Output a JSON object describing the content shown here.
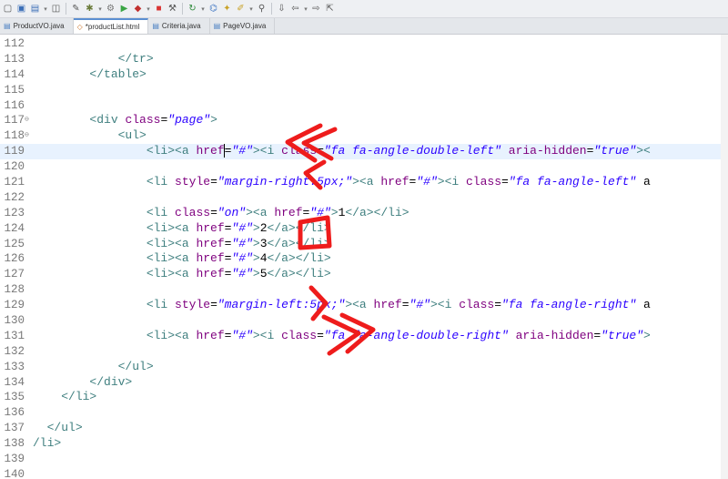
{
  "toolbar": {
    "icons": [
      "new-file-icon",
      "save-icon",
      "save-all-icon",
      "window-icon",
      "pin-icon",
      "bug-icon",
      "gear-icon",
      "run-icon",
      "external-tools-icon",
      "stop-icon",
      "build-icon",
      "refresh-icon",
      "plugin-icon",
      "wand-icon",
      "brush-icon",
      "search-icon",
      "arrow-down-icon",
      "back-icon",
      "forward-icon",
      "export-icon"
    ]
  },
  "tabs": [
    {
      "label": "ProductVO.java",
      "icon": "java-file-icon",
      "active": false
    },
    {
      "label": "*productList.html",
      "icon": "html-file-icon",
      "active": true
    },
    {
      "label": "Criteria.java",
      "icon": "java-file-icon",
      "active": false
    },
    {
      "label": "PageVO.java",
      "icon": "java-file-icon",
      "active": false
    }
  ],
  "editor": {
    "current_line": "119",
    "lines": [
      {
        "num": "112",
        "fold": "",
        "tokens": []
      },
      {
        "num": "113",
        "fold": "",
        "tokens": [
          {
            "t": "txt",
            "v": "            "
          },
          {
            "t": "tag",
            "v": "</tr>"
          }
        ]
      },
      {
        "num": "114",
        "fold": "",
        "tokens": [
          {
            "t": "txt",
            "v": "        "
          },
          {
            "t": "tag",
            "v": "</table>"
          }
        ]
      },
      {
        "num": "115",
        "fold": "",
        "tokens": []
      },
      {
        "num": "116",
        "fold": "",
        "tokens": []
      },
      {
        "num": "117",
        "fold": "⊖",
        "tokens": [
          {
            "t": "txt",
            "v": "        "
          },
          {
            "t": "tag",
            "v": "<div "
          },
          {
            "t": "attr",
            "v": "class"
          },
          {
            "t": "txt",
            "v": "="
          },
          {
            "t": "val",
            "v": "\"page\""
          },
          {
            "t": "tag",
            "v": ">"
          }
        ]
      },
      {
        "num": "118",
        "fold": "⊖",
        "tokens": [
          {
            "t": "txt",
            "v": "            "
          },
          {
            "t": "tag",
            "v": "<ul>"
          }
        ]
      },
      {
        "num": "119",
        "fold": "",
        "tokens": [
          {
            "t": "txt",
            "v": "                "
          },
          {
            "t": "tag",
            "v": "<li><a "
          },
          {
            "t": "attr",
            "v": "href"
          },
          {
            "t": "caret",
            "v": "="
          },
          {
            "t": "val",
            "v": "\"#\""
          },
          {
            "t": "tag",
            "v": "><i "
          },
          {
            "t": "attr",
            "v": "class"
          },
          {
            "t": "txt",
            "v": "="
          },
          {
            "t": "val",
            "v": "\"fa fa-angle-double-left\""
          },
          {
            "t": "txt",
            "v": " "
          },
          {
            "t": "attr",
            "v": "aria-hidden"
          },
          {
            "t": "txt",
            "v": "="
          },
          {
            "t": "val",
            "v": "\"true\""
          },
          {
            "t": "tag",
            "v": "><"
          }
        ]
      },
      {
        "num": "120",
        "fold": "",
        "tokens": []
      },
      {
        "num": "121",
        "fold": "",
        "tokens": [
          {
            "t": "txt",
            "v": "                "
          },
          {
            "t": "tag",
            "v": "<li "
          },
          {
            "t": "attr",
            "v": "style"
          },
          {
            "t": "txt",
            "v": "="
          },
          {
            "t": "val",
            "v": "\"margin-right:5px;\""
          },
          {
            "t": "tag",
            "v": "><a "
          },
          {
            "t": "attr",
            "v": "href"
          },
          {
            "t": "txt",
            "v": "="
          },
          {
            "t": "val",
            "v": "\"#\""
          },
          {
            "t": "tag",
            "v": "><i "
          },
          {
            "t": "attr",
            "v": "class"
          },
          {
            "t": "txt",
            "v": "="
          },
          {
            "t": "val",
            "v": "\"fa fa-angle-left\""
          },
          {
            "t": "txt",
            "v": " a"
          }
        ]
      },
      {
        "num": "122",
        "fold": "",
        "tokens": []
      },
      {
        "num": "123",
        "fold": "",
        "tokens": [
          {
            "t": "txt",
            "v": "                "
          },
          {
            "t": "tag",
            "v": "<li "
          },
          {
            "t": "attr",
            "v": "class"
          },
          {
            "t": "txt",
            "v": "="
          },
          {
            "t": "val",
            "v": "\"on\""
          },
          {
            "t": "tag",
            "v": "><a "
          },
          {
            "t": "attr",
            "v": "href"
          },
          {
            "t": "txt",
            "v": "="
          },
          {
            "t": "val",
            "v": "\"#\""
          },
          {
            "t": "tag",
            "v": ">"
          },
          {
            "t": "txt",
            "v": "1"
          },
          {
            "t": "tag",
            "v": "</a></li>"
          }
        ]
      },
      {
        "num": "124",
        "fold": "",
        "tokens": [
          {
            "t": "txt",
            "v": "                "
          },
          {
            "t": "tag",
            "v": "<li><a "
          },
          {
            "t": "attr",
            "v": "href"
          },
          {
            "t": "txt",
            "v": "="
          },
          {
            "t": "val",
            "v": "\"#\""
          },
          {
            "t": "tag",
            "v": ">"
          },
          {
            "t": "txt",
            "v": "2"
          },
          {
            "t": "tag",
            "v": "</a></li>"
          }
        ]
      },
      {
        "num": "125",
        "fold": "",
        "tokens": [
          {
            "t": "txt",
            "v": "                "
          },
          {
            "t": "tag",
            "v": "<li><a "
          },
          {
            "t": "attr",
            "v": "href"
          },
          {
            "t": "txt",
            "v": "="
          },
          {
            "t": "val",
            "v": "\"#\""
          },
          {
            "t": "tag",
            "v": ">"
          },
          {
            "t": "txt",
            "v": "3"
          },
          {
            "t": "tag",
            "v": "</a></li>"
          }
        ]
      },
      {
        "num": "126",
        "fold": "",
        "tokens": [
          {
            "t": "txt",
            "v": "                "
          },
          {
            "t": "tag",
            "v": "<li><a "
          },
          {
            "t": "attr",
            "v": "href"
          },
          {
            "t": "txt",
            "v": "="
          },
          {
            "t": "val",
            "v": "\"#\""
          },
          {
            "t": "tag",
            "v": ">"
          },
          {
            "t": "txt",
            "v": "4"
          },
          {
            "t": "tag",
            "v": "</a></li>"
          }
        ]
      },
      {
        "num": "127",
        "fold": "",
        "tokens": [
          {
            "t": "txt",
            "v": "                "
          },
          {
            "t": "tag",
            "v": "<li><a "
          },
          {
            "t": "attr",
            "v": "href"
          },
          {
            "t": "txt",
            "v": "="
          },
          {
            "t": "val",
            "v": "\"#\""
          },
          {
            "t": "tag",
            "v": ">"
          },
          {
            "t": "txt",
            "v": "5"
          },
          {
            "t": "tag",
            "v": "</a></li>"
          }
        ]
      },
      {
        "num": "128",
        "fold": "",
        "tokens": []
      },
      {
        "num": "129",
        "fold": "",
        "tokens": [
          {
            "t": "txt",
            "v": "                "
          },
          {
            "t": "tag",
            "v": "<li "
          },
          {
            "t": "attr",
            "v": "style"
          },
          {
            "t": "txt",
            "v": "="
          },
          {
            "t": "val",
            "v": "\"margin-left:5px;\""
          },
          {
            "t": "tag",
            "v": "><a "
          },
          {
            "t": "attr",
            "v": "href"
          },
          {
            "t": "txt",
            "v": "="
          },
          {
            "t": "val",
            "v": "\"#\""
          },
          {
            "t": "tag",
            "v": "><i "
          },
          {
            "t": "attr",
            "v": "class"
          },
          {
            "t": "txt",
            "v": "="
          },
          {
            "t": "val",
            "v": "\"fa fa-angle-right\""
          },
          {
            "t": "txt",
            "v": " a"
          }
        ]
      },
      {
        "num": "130",
        "fold": "",
        "tokens": []
      },
      {
        "num": "131",
        "fold": "",
        "tokens": [
          {
            "t": "txt",
            "v": "                "
          },
          {
            "t": "tag",
            "v": "<li><a "
          },
          {
            "t": "attr",
            "v": "href"
          },
          {
            "t": "txt",
            "v": "="
          },
          {
            "t": "val",
            "v": "\"#\""
          },
          {
            "t": "tag",
            "v": "><i "
          },
          {
            "t": "attr",
            "v": "class"
          },
          {
            "t": "txt",
            "v": "="
          },
          {
            "t": "val",
            "v": "\"fa fa-angle-double-right\""
          },
          {
            "t": "txt",
            "v": " "
          },
          {
            "t": "attr",
            "v": "aria-hidden"
          },
          {
            "t": "txt",
            "v": "="
          },
          {
            "t": "val",
            "v": "\"true\""
          },
          {
            "t": "tag",
            "v": ">"
          }
        ]
      },
      {
        "num": "132",
        "fold": "",
        "tokens": []
      },
      {
        "num": "133",
        "fold": "",
        "tokens": [
          {
            "t": "txt",
            "v": "            "
          },
          {
            "t": "tag",
            "v": "</ul>"
          }
        ]
      },
      {
        "num": "134",
        "fold": "",
        "tokens": [
          {
            "t": "txt",
            "v": "        "
          },
          {
            "t": "tag",
            "v": "</div>"
          }
        ]
      },
      {
        "num": "135",
        "fold": "",
        "tokens": [
          {
            "t": "txt",
            "v": "    "
          },
          {
            "t": "tag",
            "v": "</li>"
          }
        ]
      },
      {
        "num": "136",
        "fold": "",
        "tokens": []
      },
      {
        "num": "137",
        "fold": "",
        "tokens": [
          {
            "t": "txt",
            "v": "  "
          },
          {
            "t": "tag",
            "v": "</ul>"
          }
        ]
      },
      {
        "num": "138",
        "fold": "",
        "tokens": [
          {
            "t": "tag",
            "v": "/li>"
          }
        ]
      },
      {
        "num": "139",
        "fold": "",
        "tokens": []
      },
      {
        "num": "140",
        "fold": "",
        "tokens": []
      }
    ]
  },
  "annotations": {
    "color": "#ee1c1c"
  },
  "colors": {
    "tag": "#3f7f7f",
    "attribute": "#7f007f",
    "value": "#2a00ff",
    "current_line": "#e8f2fe",
    "active_tab_accent": "#5b8fd1"
  }
}
